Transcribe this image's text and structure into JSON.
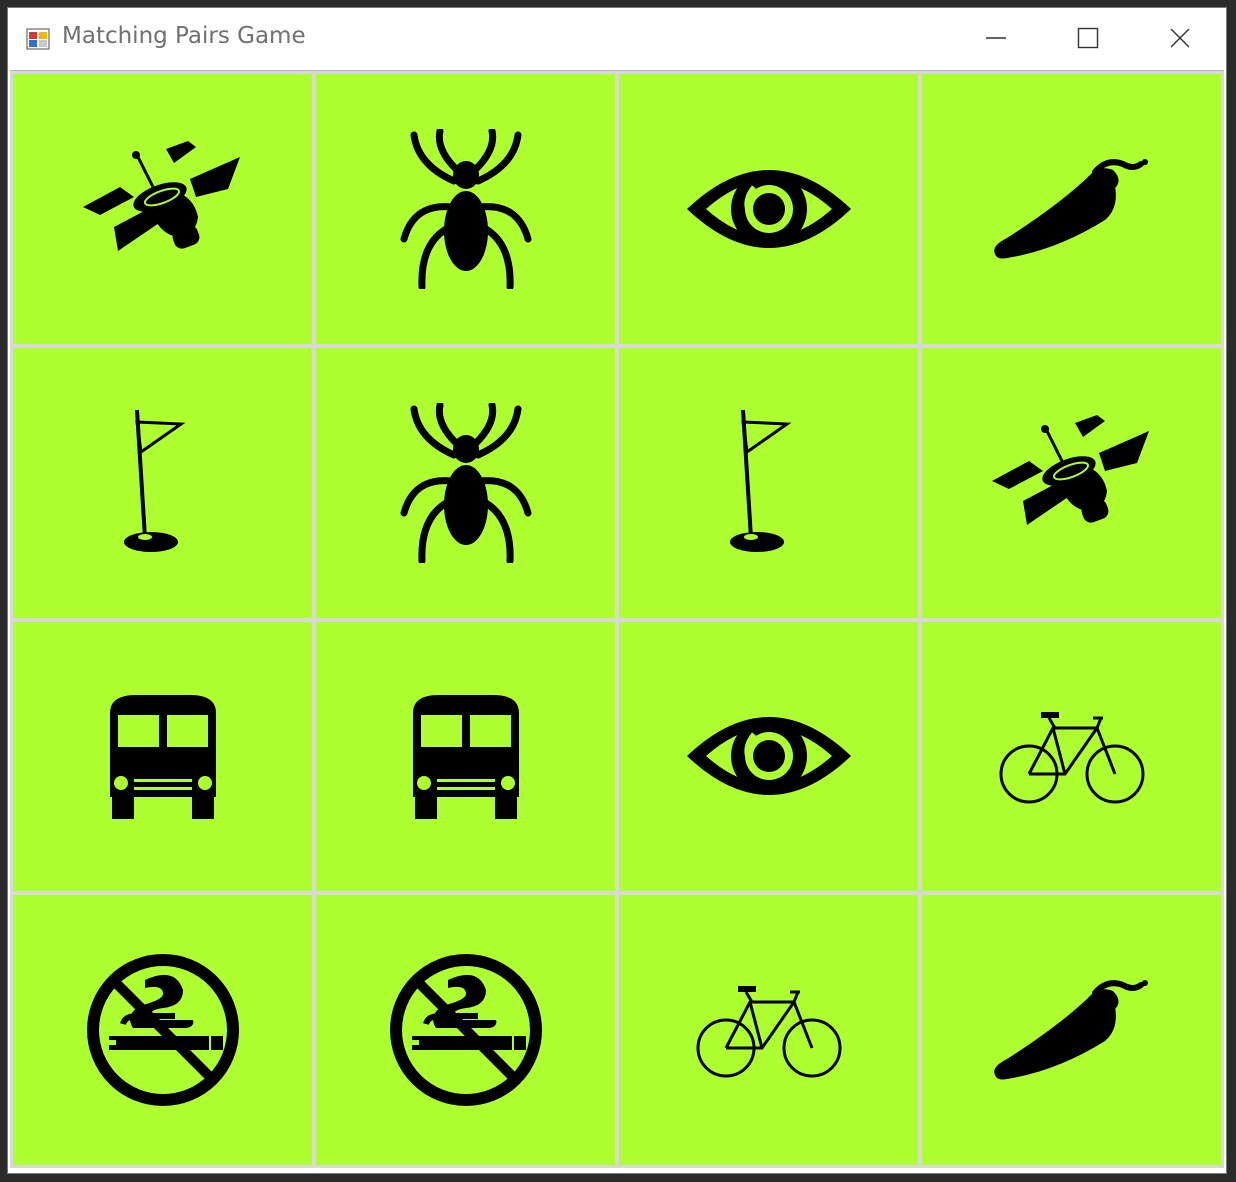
{
  "window": {
    "title": "Matching Pairs Game"
  },
  "colors": {
    "card_background": "#adff2f",
    "icon_color": "#000000"
  },
  "board": {
    "rows": 4,
    "columns": 4,
    "cards": [
      {
        "icon": "satellite-icon"
      },
      {
        "icon": "spider-icon"
      },
      {
        "icon": "eye-icon"
      },
      {
        "icon": "chili-pepper-icon"
      },
      {
        "icon": "golf-flag-icon"
      },
      {
        "icon": "spider-icon"
      },
      {
        "icon": "golf-flag-icon"
      },
      {
        "icon": "satellite-icon"
      },
      {
        "icon": "bus-icon"
      },
      {
        "icon": "bus-icon"
      },
      {
        "icon": "eye-icon"
      },
      {
        "icon": "bicycle-icon"
      },
      {
        "icon": "no-smoking-icon"
      },
      {
        "icon": "no-smoking-icon"
      },
      {
        "icon": "bicycle-icon"
      },
      {
        "icon": "chili-pepper-icon"
      }
    ]
  }
}
